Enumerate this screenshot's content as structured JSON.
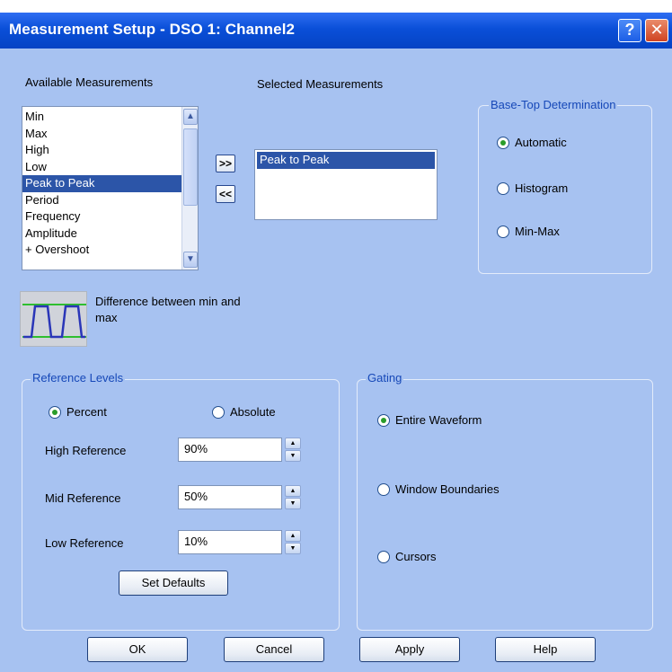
{
  "window": {
    "title": "Measurement Setup - DSO 1: Channel2"
  },
  "titlebar": {
    "help_glyph": "?",
    "close_glyph": "✕"
  },
  "available": {
    "label": "Available Measurements",
    "items": [
      "Min",
      "Max",
      "High",
      "Low",
      "Peak to Peak",
      "Period",
      "Frequency",
      "Amplitude",
      "+ Overshoot"
    ],
    "selected_index": 4
  },
  "transfer": {
    "add_label": ">>",
    "remove_label": "<<"
  },
  "selected": {
    "label": "Selected Measurements",
    "items": [
      "Peak to Peak"
    ]
  },
  "description": {
    "line1": "Difference between min and",
    "line2": "max",
    "icon": "waveform-icon"
  },
  "base_top": {
    "title": "Base-Top Determination",
    "options": [
      "Automatic",
      "Histogram",
      "Min-Max"
    ],
    "selected": "Automatic"
  },
  "reference_levels": {
    "title": "Reference Levels",
    "options": [
      "Percent",
      "Absolute"
    ],
    "selected": "Percent",
    "high_label": "High Reference",
    "high_value": "90%",
    "mid_label": "Mid Reference",
    "mid_value": "50%",
    "low_label": "Low Reference",
    "low_value": "10%",
    "defaults_label": "Set Defaults"
  },
  "gating": {
    "title": "Gating",
    "options": [
      "Entire Waveform",
      "Window Boundaries",
      "Cursors"
    ],
    "selected": "Entire Waveform"
  },
  "footer": {
    "ok": "OK",
    "cancel": "Cancel",
    "apply": "Apply",
    "help": "Help"
  },
  "colors": {
    "dialog_bg": "#a7c2f1",
    "title_bar": "#0a4fd8",
    "selection": "#2c55a8",
    "group_title": "#1648b8",
    "radio_dot": "#2a9d2a"
  }
}
